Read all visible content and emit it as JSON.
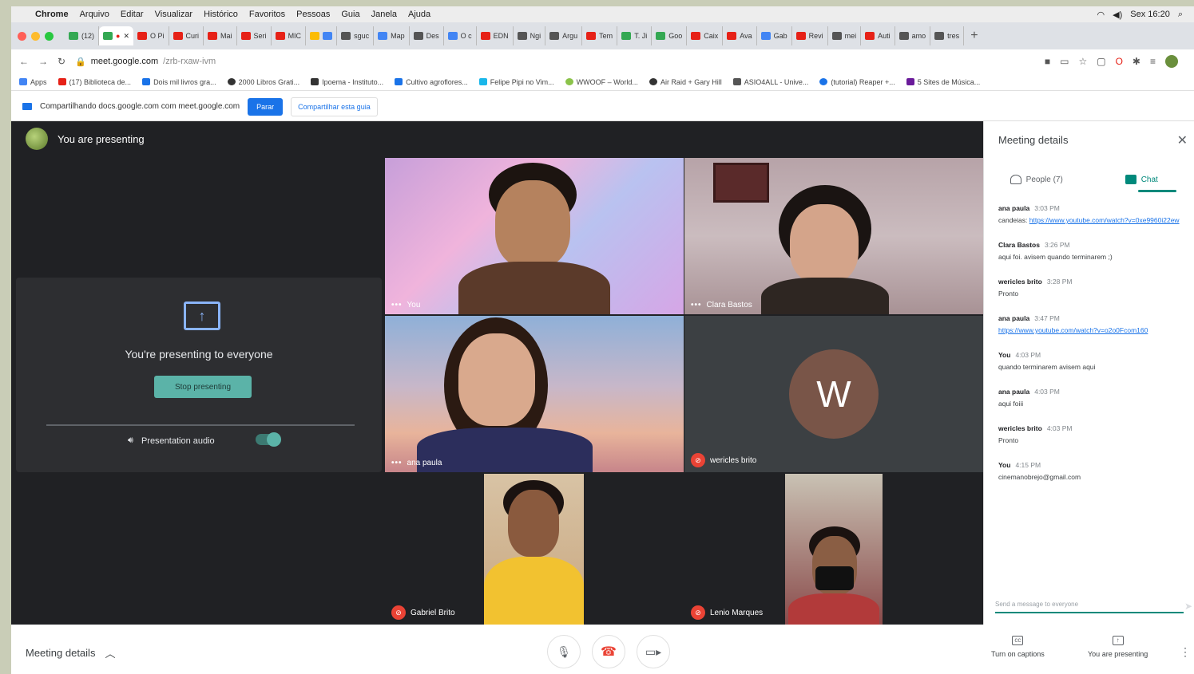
{
  "menubar": {
    "app": "Chrome",
    "items": [
      "Arquivo",
      "Editar",
      "Visualizar",
      "Histórico",
      "Favoritos",
      "Pessoas",
      "Guia",
      "Janela",
      "Ajuda"
    ],
    "clock": "Sex 16:20"
  },
  "tabs": [
    "(12)",
    "",
    "O Pi",
    "Curi",
    "Mai",
    "Seri",
    "MIC",
    "",
    "sguc",
    "Map",
    "Des",
    "O c",
    "EDN",
    "Ngi",
    "Argu",
    "Tem",
    "T. Ji",
    "Goo",
    "Caix",
    "Ava",
    "Gab",
    "Revi",
    "mei",
    "Auti",
    "amo",
    "tres"
  ],
  "address": {
    "domain": "meet.google.com",
    "path": "/zrb-rxaw-ivm"
  },
  "bookmarks": [
    "Apps",
    "(17) Biblioteca de...",
    "Dois mil livros gra...",
    "2000 Libros Grati...",
    "Ipoema - Instituto...",
    "Cultivo agroflores...",
    "Felipe Pipi no Vim...",
    "WWOOF – World...",
    "Air Raid + Gary Hill",
    "ASIO4ALL - Unive...",
    "(tutorial) Reaper +...",
    "5 Sites de Música..."
  ],
  "sharebar": {
    "text": "Compartilhando docs.google.com com meet.google.com",
    "stop": "Parar",
    "share_tab": "Compartilhar esta guia"
  },
  "meet": {
    "presenting_header": "You are presenting",
    "presenting_to_everyone": "You're presenting to everyone",
    "stop_presenting": "Stop presenting",
    "presentation_audio": "Presentation audio",
    "presentation_audio_on": true
  },
  "participants": [
    {
      "name": "You"
    },
    {
      "name": "Clara Bastos"
    },
    {
      "name": "ana paula"
    },
    {
      "name": "wericles brito",
      "initial": "W",
      "avatar_color": "#795548"
    },
    {
      "name": "Gabriel Brito"
    },
    {
      "name": "Lenio Marques"
    }
  ],
  "panel": {
    "title": "Meeting details",
    "tab_people": "People (7)",
    "tab_chat": "Chat",
    "messages": [
      {
        "who": "ana paula",
        "time": "3:03 PM",
        "text": "candeias: ",
        "link": "https://www.youtube.com/watch?v=0xe9960i22ew"
      },
      {
        "who": "Clara Bastos",
        "time": "3:26 PM",
        "text": "aqui foi. avisem quando terminarem ;)",
        "link": ""
      },
      {
        "who": "wericles brito",
        "time": "3:28 PM",
        "text": "Pronto",
        "link": ""
      },
      {
        "who": "ana paula",
        "time": "3:47 PM",
        "text": "",
        "link": "https://www.youtube.com/watch?v=o2o0Fcom160"
      },
      {
        "who": "You",
        "time": "4:03 PM",
        "text": "quando terminarem avisem aqui",
        "link": ""
      },
      {
        "who": "ana paula",
        "time": "4:03 PM",
        "text": "aqui foiii",
        "link": ""
      },
      {
        "who": "wericles brito",
        "time": "4:03 PM",
        "text": "Pronto",
        "link": ""
      },
      {
        "who": "You",
        "time": "4:15 PM",
        "text": "cinemanobrejo@gmail.com",
        "link": ""
      }
    ],
    "send_placeholder": "Send a message to everyone"
  },
  "bottombar": {
    "meeting_details": "Meeting details",
    "captions": "Turn on captions",
    "presenting": "You are presenting"
  }
}
